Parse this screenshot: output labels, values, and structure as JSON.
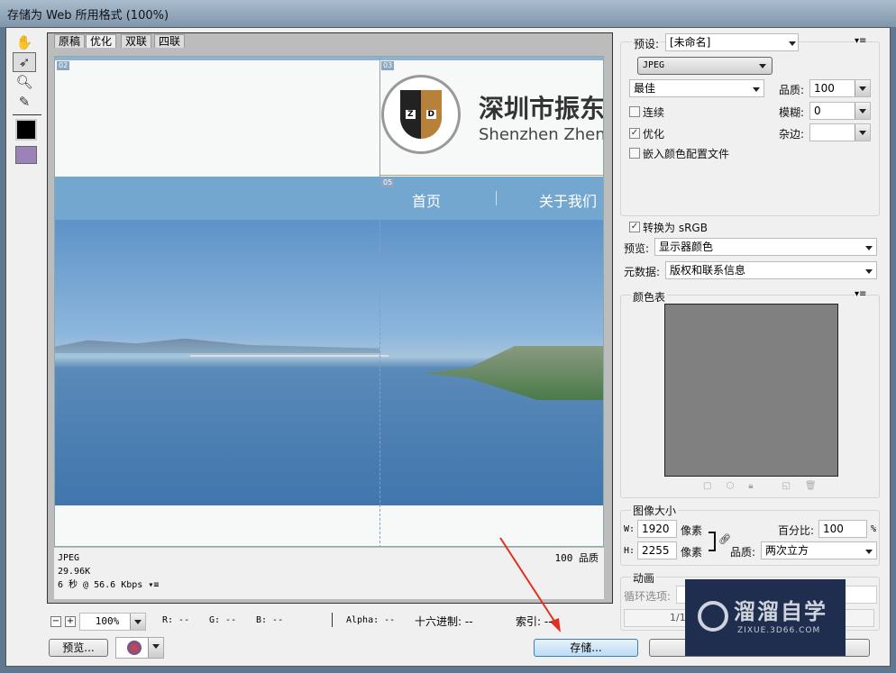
{
  "window": {
    "title": "存储为 Web 所用格式 (100%)"
  },
  "tools": [
    "hand-icon",
    "slice-select-icon",
    "zoom-icon",
    "eyedropper-icon",
    "color-swatch",
    "toggle-slices-icon"
  ],
  "tabs": [
    {
      "label": "原稿"
    },
    {
      "label": "优化",
      "active": true
    },
    {
      "label": "双联"
    },
    {
      "label": "四联"
    }
  ],
  "preview": {
    "slices": [
      "02",
      "03",
      "05"
    ],
    "company_cn": "深圳市振东",
    "company_en": "Shenzhen Zhenc",
    "logo_text": "ZHENDONG TENDERING",
    "logo_letters": [
      "Z",
      "D"
    ],
    "nav": [
      "首页",
      "关于我们"
    ]
  },
  "info": {
    "format": "JPEG",
    "size": "29.96K",
    "time": "6 秒 @ 56.6 Kbps",
    "quality": "100 品质"
  },
  "statusbar": {
    "zoom": "100%",
    "r": "R: --",
    "g": "G: --",
    "b": "B: --",
    "alpha": "Alpha: --",
    "hex": "十六进制: --",
    "index": "索引: --"
  },
  "buttons": {
    "preview": "预览...",
    "save": "存储..."
  },
  "settings": {
    "preset_label": "预设:",
    "preset": "[未命名]",
    "format": "JPEG",
    "quality_preset": "最佳",
    "quality_label": "品质:",
    "quality": "100",
    "blur_label": "模糊:",
    "blur": "0",
    "matte_label": "杂边:",
    "matte": "",
    "progressive": {
      "label": "连续",
      "checked": false
    },
    "optimized": {
      "label": "优化",
      "checked": true
    },
    "embed_profile": {
      "label": "嵌入颜色配置文件",
      "checked": false
    },
    "srgb": {
      "label": "转换为 sRGB",
      "checked": true
    },
    "preview_label": "预览:",
    "preview_value": "显示器颜色",
    "metadata_label": "元数据:",
    "metadata_value": "版权和联系信息"
  },
  "color_table": {
    "title": "颜色表",
    "color": "#808080"
  },
  "image_size": {
    "title": "图像大小",
    "w_label": "W:",
    "w": "1920",
    "h_label": "H:",
    "h": "2255",
    "unit": "像素",
    "percent_label": "百分比:",
    "percent": "100",
    "percent_unit": "%",
    "quality_label": "品质:",
    "quality": "两次立方"
  },
  "animation": {
    "title": "动画",
    "loop_label": "循环选项:",
    "frame": "1/1"
  },
  "watermark": {
    "cn": "溜溜自学",
    "url": "ZIXUE.3D66.COM"
  },
  "colors": {
    "accent": "#e03020",
    "nav_band": "#74a7cf",
    "watermark_bg": "#1f2d4f"
  }
}
